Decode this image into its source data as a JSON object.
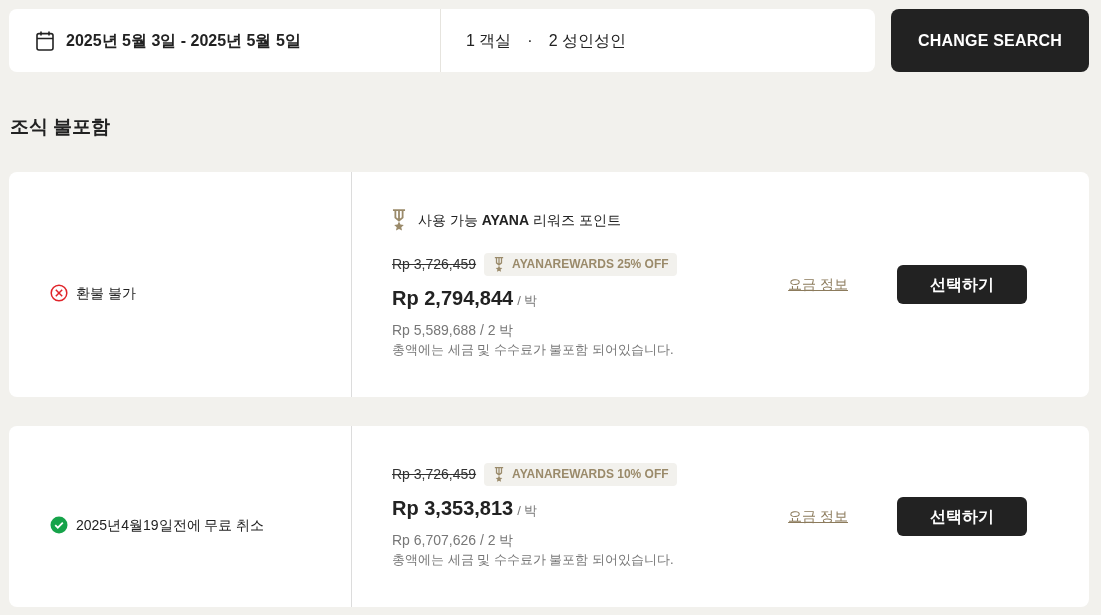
{
  "search_bar": {
    "dates": "2025년 5월 3일 - 2025년 5월 5일",
    "rooms": "1 객실",
    "separator": "·",
    "guests": "2 성인성인"
  },
  "change_search_button": "CHANGE SEARCH",
  "section_title": "조식 불포함",
  "rates": [
    {
      "policy": {
        "kind": "non_refundable",
        "text": "환불 불가"
      },
      "rewards_note": "사용 가능 **AYANA** 리워즈 포인트",
      "original_price": "Rp 3,726,459",
      "discount_badge": "AYANAREWARDS 25% OFF",
      "price": "Rp 2,794,844",
      "per_night": "/ 박",
      "total": "Rp 5,589,688 / 2 박",
      "tax_note": "총액에는 세금 및 수수료가 불포함 되어있습니다.",
      "details_link": "요금 정보",
      "select_button": "선택하기"
    },
    {
      "policy": {
        "kind": "free_cancellation",
        "text": "2025년4월19일전에 무료 취소"
      },
      "original_price": "Rp 3,726,459",
      "discount_badge": "AYANAREWARDS 10% OFF",
      "price": "Rp 3,353,813",
      "per_night": "/ 박",
      "total": "Rp 6,707,626 / 2 박",
      "tax_note": "총액에는 세금 및 수수료가 불포함 되어있습니다.",
      "details_link": "요금 정보",
      "select_button": "선택하기"
    }
  ]
}
